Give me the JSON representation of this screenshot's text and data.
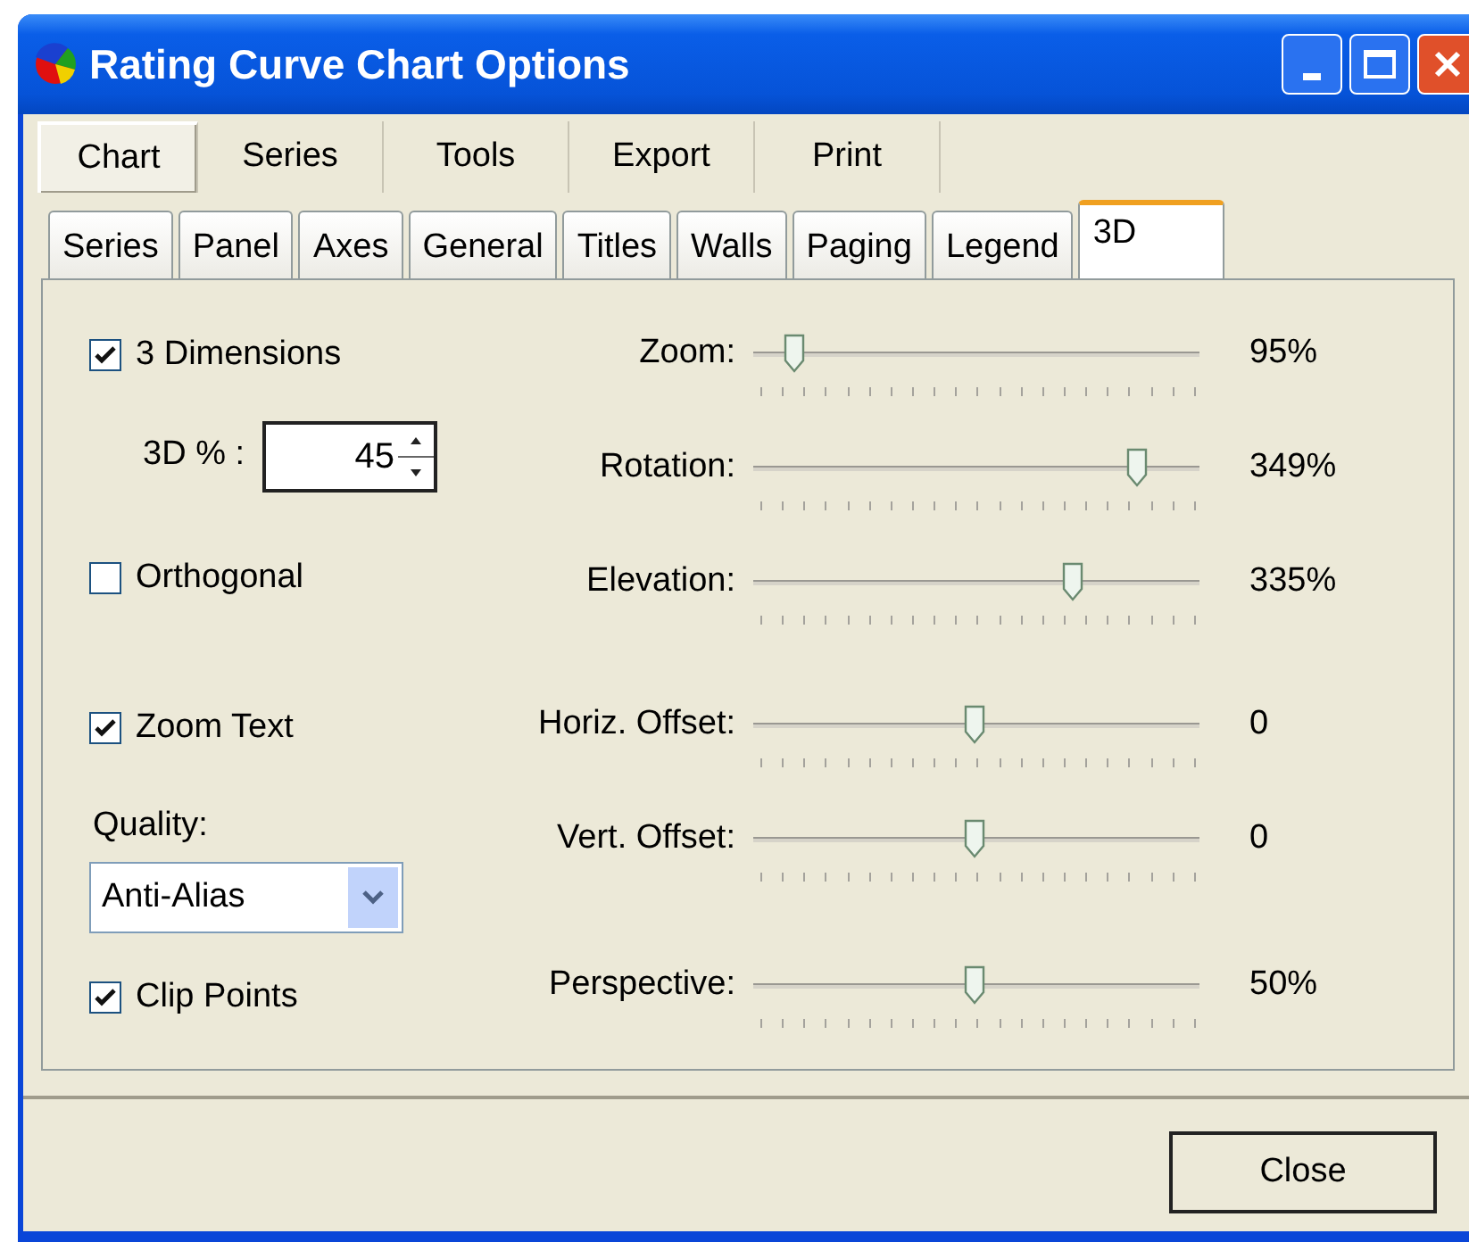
{
  "window": {
    "title": "Rating Curve Chart Options"
  },
  "tabs": [
    {
      "label": "Chart",
      "selected": true
    },
    {
      "label": "Series",
      "selected": false
    },
    {
      "label": "Tools",
      "selected": false
    },
    {
      "label": "Export",
      "selected": false
    },
    {
      "label": "Print",
      "selected": false
    }
  ],
  "subtabs": [
    {
      "label": "Series",
      "selected": false
    },
    {
      "label": "Panel",
      "selected": false
    },
    {
      "label": "Axes",
      "selected": false
    },
    {
      "label": "General",
      "selected": false
    },
    {
      "label": "Titles",
      "selected": false
    },
    {
      "label": "Walls",
      "selected": false
    },
    {
      "label": "Paging",
      "selected": false
    },
    {
      "label": "Legend",
      "selected": false
    },
    {
      "label": "3D",
      "selected": true
    }
  ],
  "three_d": {
    "label": "3 Dimensions",
    "checked": true
  },
  "percent": {
    "label": "3D % :",
    "value": "45"
  },
  "orthogonal": {
    "label": "Orthogonal",
    "checked": false
  },
  "zoom_text": {
    "label": "Zoom Text",
    "checked": true
  },
  "quality": {
    "label": "Quality:",
    "value": "Anti-Alias"
  },
  "clip_points": {
    "label": "Clip Points",
    "checked": true
  },
  "sliders": [
    {
      "label": "Zoom:",
      "level": 0.1,
      "reading": "95%"
    },
    {
      "label": "Rotation:",
      "level": 0.86,
      "reading": "349%"
    },
    {
      "label": "Elevation:",
      "level": 0.72,
      "reading": "335%"
    },
    {
      "label": "Horiz. Offset:",
      "level": 0.5,
      "reading": "0"
    },
    {
      "label": "Vert. Offset:",
      "level": 0.5,
      "reading": "0"
    },
    {
      "label": "Perspective:",
      "level": 0.5,
      "reading": "50%"
    }
  ],
  "buttons": [
    {
      "label": "Close"
    }
  ]
}
